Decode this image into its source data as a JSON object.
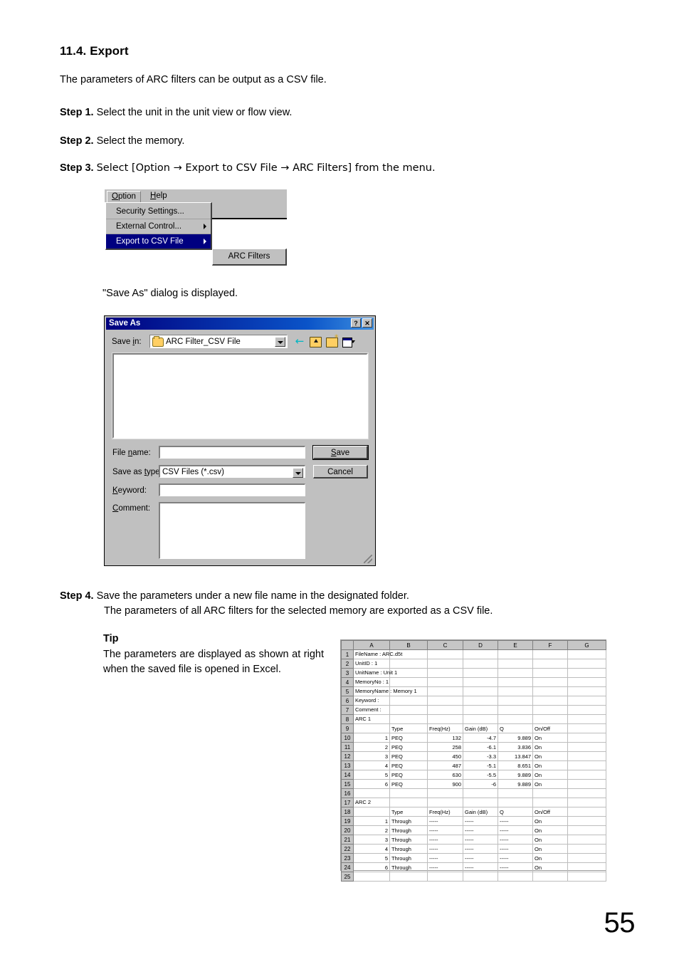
{
  "document": {
    "section_heading": "11.4. Export",
    "intro": "The parameters of ARC filters can be output as a CSV file.",
    "steps": [
      {
        "label": "Step 1.",
        "text": "Select the unit in the unit view or flow view."
      },
      {
        "label": "Step 2.",
        "text": "Select the memory."
      },
      {
        "label": "Step 3.",
        "text": "Select [Option → Export to CSV File → ARC Filters] from the menu."
      },
      {
        "label": "Step 4.",
        "text": "Save the parameters under a new file name in the designated folder.",
        "text2": "The parameters of all ARC filters for the selected memory are exported as a CSV file."
      }
    ],
    "dialog_caption": "\"Save As\" dialog is displayed.",
    "tip": {
      "title": "Tip",
      "body": "The parameters are displayed as shown at right when the saved file is opened in Excel."
    },
    "page_number": "55"
  },
  "menu_shot": {
    "menubar": [
      {
        "label": "Option",
        "underline_index": 0,
        "active": true
      },
      {
        "label": "Help",
        "underline_index": 0,
        "active": false
      }
    ],
    "option_menu": [
      {
        "label": "Security Settings...",
        "has_submenu": false,
        "highlighted": false
      },
      {
        "label": "External Control...",
        "has_submenu": true,
        "highlighted": false
      },
      {
        "label": "Export to CSV File",
        "has_submenu": true,
        "highlighted": true
      }
    ],
    "submenu": [
      {
        "label": "ARC Filters"
      }
    ],
    "highlight_color": "#000080",
    "face_color": "#c0c0c0"
  },
  "save_as_dialog": {
    "title": "Save As",
    "title_buttons": [
      {
        "name": "help-button",
        "glyph": "?"
      },
      {
        "name": "close-button",
        "glyph": "✕"
      }
    ],
    "save_in": {
      "label": "Save in:",
      "value": "ARC Filter_CSV File"
    },
    "toolbar_icons": [
      "back-icon",
      "up-one-level-icon",
      "new-folder-icon",
      "views-icon"
    ],
    "file_name": {
      "label": "File name:",
      "value": ""
    },
    "save_as_type": {
      "label": "Save as type:",
      "value": "CSV Files (*.csv)"
    },
    "keyword": {
      "label": "Keyword:",
      "value": ""
    },
    "comment": {
      "label": "Comment:",
      "value": ""
    },
    "buttons": {
      "save": "Save",
      "cancel": "Cancel"
    },
    "titlebar_color": "#000080"
  },
  "excel": {
    "column_headers": [
      "",
      "A",
      "B",
      "C",
      "D",
      "E",
      "F",
      "G"
    ],
    "rows": [
      {
        "n": "1",
        "cells": [
          "FileName : ARC.d5t",
          "",
          "",
          "",
          "",
          "",
          ""
        ],
        "spill": 0
      },
      {
        "n": "2",
        "cells": [
          "UnitID : 1",
          "",
          "",
          "",
          "",
          "",
          ""
        ],
        "spill": 0
      },
      {
        "n": "3",
        "cells": [
          "UnitName : Unit 1",
          "",
          "",
          "",
          "",
          "",
          ""
        ],
        "spill": 0
      },
      {
        "n": "4",
        "cells": [
          "MemoryNo : 1",
          "",
          "",
          "",
          "",
          "",
          ""
        ],
        "spill": 0
      },
      {
        "n": "5",
        "cells": [
          "MemoryName : Memory 1",
          "",
          "",
          "",
          "",
          "",
          ""
        ],
        "spill": 0
      },
      {
        "n": "6",
        "cells": [
          "Keyword :",
          "",
          "",
          "",
          "",
          "",
          ""
        ],
        "spill": 0
      },
      {
        "n": "7",
        "cells": [
          "Comment :",
          "",
          "",
          "",
          "",
          "",
          ""
        ],
        "spill": 0
      },
      {
        "n": "8",
        "cells": [
          "ARC 1",
          "",
          "",
          "",
          "",
          "",
          ""
        ],
        "spill": 0
      },
      {
        "n": "9",
        "cells": [
          "",
          "Type",
          "Freq(Hz)",
          "Gain (dB)",
          "Q",
          "On/Off",
          ""
        ],
        "spill": -1
      },
      {
        "n": "10",
        "cells": [
          "1",
          "PEQ",
          "132",
          "-4.7",
          "9.889",
          "On",
          ""
        ],
        "align": [
          "r",
          "l",
          "r",
          "r",
          "r",
          "l",
          "l"
        ]
      },
      {
        "n": "11",
        "cells": [
          "2",
          "PEQ",
          "258",
          "-6.1",
          "3.836",
          "On",
          ""
        ],
        "align": [
          "r",
          "l",
          "r",
          "r",
          "r",
          "l",
          "l"
        ]
      },
      {
        "n": "12",
        "cells": [
          "3",
          "PEQ",
          "450",
          "-3.3",
          "13.847",
          "On",
          ""
        ],
        "align": [
          "r",
          "l",
          "r",
          "r",
          "r",
          "l",
          "l"
        ]
      },
      {
        "n": "13",
        "cells": [
          "4",
          "PEQ",
          "487",
          "-5.1",
          "8.651",
          "On",
          ""
        ],
        "align": [
          "r",
          "l",
          "r",
          "r",
          "r",
          "l",
          "l"
        ]
      },
      {
        "n": "14",
        "cells": [
          "5",
          "PEQ",
          "630",
          "-5.5",
          "9.889",
          "On",
          ""
        ],
        "align": [
          "r",
          "l",
          "r",
          "r",
          "r",
          "l",
          "l"
        ]
      },
      {
        "n": "15",
        "cells": [
          "6",
          "PEQ",
          "900",
          "-6",
          "9.889",
          "On",
          ""
        ],
        "align": [
          "r",
          "l",
          "r",
          "r",
          "r",
          "l",
          "l"
        ]
      },
      {
        "n": "16",
        "cells": [
          "",
          "",
          "",
          "",
          "",
          "",
          ""
        ],
        "spill": -1
      },
      {
        "n": "17",
        "cells": [
          "ARC 2",
          "",
          "",
          "",
          "",
          "",
          ""
        ],
        "spill": 0
      },
      {
        "n": "18",
        "cells": [
          "",
          "Type",
          "Freq(Hz)",
          "Gain (dB)",
          "Q",
          "On/Off",
          ""
        ],
        "spill": -1
      },
      {
        "n": "19",
        "cells": [
          "1",
          "Through",
          "-----",
          "-----",
          "-----",
          "On",
          ""
        ],
        "align": [
          "r",
          "l",
          "l",
          "l",
          "l",
          "l",
          "l"
        ]
      },
      {
        "n": "20",
        "cells": [
          "2",
          "Through",
          "-----",
          "-----",
          "-----",
          "On",
          ""
        ],
        "align": [
          "r",
          "l",
          "l",
          "l",
          "l",
          "l",
          "l"
        ]
      },
      {
        "n": "21",
        "cells": [
          "3",
          "Through",
          "-----",
          "-----",
          "-----",
          "On",
          ""
        ],
        "align": [
          "r",
          "l",
          "l",
          "l",
          "l",
          "l",
          "l"
        ]
      },
      {
        "n": "22",
        "cells": [
          "4",
          "Through",
          "-----",
          "-----",
          "-----",
          "On",
          ""
        ],
        "align": [
          "r",
          "l",
          "l",
          "l",
          "l",
          "l",
          "l"
        ]
      },
      {
        "n": "23",
        "cells": [
          "5",
          "Through",
          "-----",
          "-----",
          "-----",
          "On",
          ""
        ],
        "align": [
          "r",
          "l",
          "l",
          "l",
          "l",
          "l",
          "l"
        ]
      },
      {
        "n": "24",
        "cells": [
          "6",
          "Through",
          "-----",
          "-----",
          "-----",
          "On",
          ""
        ],
        "align": [
          "r",
          "l",
          "l",
          "l",
          "l",
          "l",
          "l"
        ]
      },
      {
        "n": "25",
        "cells": [
          "",
          "",
          "",
          "",
          "",
          "",
          ""
        ],
        "spill": -1
      }
    ]
  }
}
